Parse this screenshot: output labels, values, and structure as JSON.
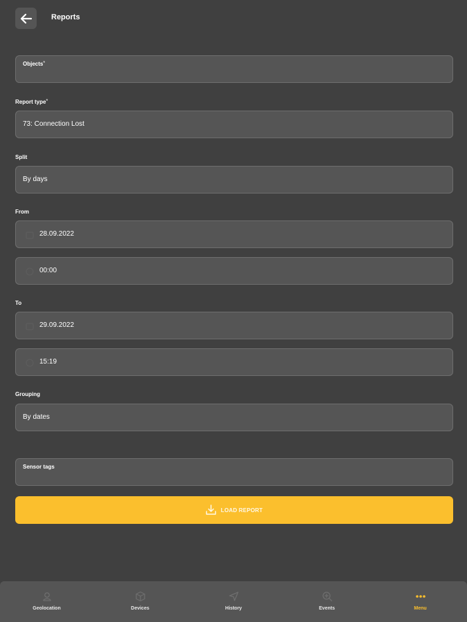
{
  "header": {
    "title": "Reports"
  },
  "form": {
    "objects_label": "Objects",
    "required_mark": "*",
    "report_type_label": "Report type",
    "report_type_value": "73: Connection Lost",
    "split_label": "Split",
    "split_value": "By days",
    "from_label": "From",
    "from_date": "28.09.2022",
    "from_time": "00:00",
    "to_label": "To",
    "to_date": "29.09.2022",
    "to_time": "15:19",
    "grouping_label": "Grouping",
    "grouping_value": "By dates",
    "sensor_tags_label": "Sensor tags"
  },
  "load_button": {
    "label": "LOAD REPORT"
  },
  "nav": {
    "items": [
      {
        "label": "Geolocation",
        "icon": "person-pin-icon"
      },
      {
        "label": "Devices",
        "icon": "box-icon"
      },
      {
        "label": "History",
        "icon": "navigation-arrow-icon"
      },
      {
        "label": "Events",
        "icon": "search-plus-icon"
      },
      {
        "label": "Menu",
        "icon": "dots-icon"
      }
    ],
    "active": "Menu"
  },
  "colors": {
    "background": "#404040",
    "field": "#555555",
    "accent": "#fbbf2d"
  }
}
